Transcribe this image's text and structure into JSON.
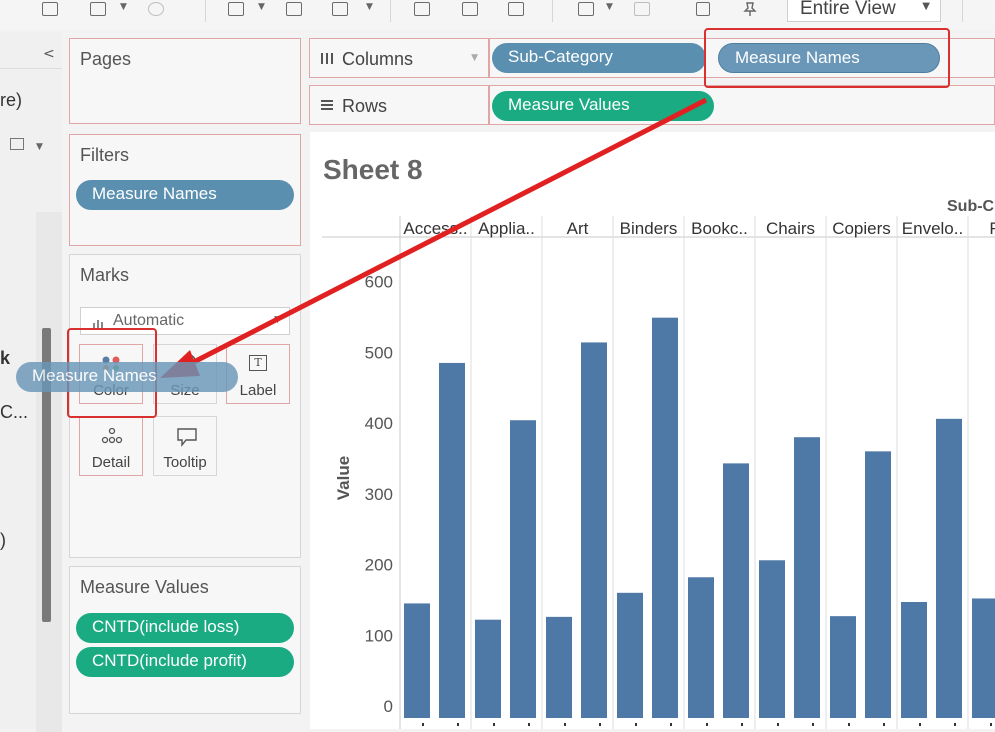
{
  "toolbar": {
    "fit_label": "Entire View"
  },
  "data_pane": {
    "fragments": [
      "re)",
      "k",
      "C...",
      ")"
    ]
  },
  "pages": {
    "title": "Pages"
  },
  "filters": {
    "title": "Filters",
    "pills": [
      "Measure Names"
    ]
  },
  "marks": {
    "title": "Marks",
    "type_selected": "Automatic",
    "buttons": [
      {
        "label": "Color",
        "icon": "color-icon"
      },
      {
        "label": "Size",
        "icon": "size-icon"
      },
      {
        "label": "Label",
        "icon": "label-icon"
      },
      {
        "label": "Detail",
        "icon": "detail-icon"
      },
      {
        "label": "Tooltip",
        "icon": "tooltip-icon"
      }
    ],
    "label_glyph": "T"
  },
  "measure_values": {
    "title": "Measure Values",
    "pills": [
      "CNTD(include loss)",
      "CNTD(include profit)"
    ]
  },
  "shelves": {
    "columns": {
      "label": "Columns",
      "pills": [
        "Sub-Category",
        "Measure Names"
      ]
    },
    "rows": {
      "label": "Rows",
      "pills": [
        "Measure Values"
      ]
    }
  },
  "drag_pill": "Measure Names",
  "sheet": {
    "title": "Sheet 8",
    "header_label": "Sub-C"
  },
  "chart_data": {
    "type": "bar",
    "ylabel": "Value",
    "ylim": [
      0,
      650
    ],
    "yticks": [
      0,
      100,
      200,
      300,
      400,
      500,
      600
    ],
    "categories": [
      "Access..",
      "Applia..",
      "Art",
      "Binders",
      "Bookc..",
      "Chairs",
      "Copiers",
      "Envelo..",
      "Fas"
    ],
    "series": [
      {
        "name": "CNTD(include loss)",
        "values": [
          162,
          139,
          143,
          177,
          199,
          223,
          144,
          164,
          169
        ]
      },
      {
        "name": "CNTD(include profit)",
        "values": [
          502,
          421,
          531,
          566,
          360,
          397,
          377,
          423,
          null
        ]
      }
    ],
    "bar_color": "#4e79a7",
    "grid": false
  },
  "colors": {
    "blue_pill": "#5a8fb0",
    "green_pill": "#1bab82",
    "annotation": "#d93030"
  }
}
